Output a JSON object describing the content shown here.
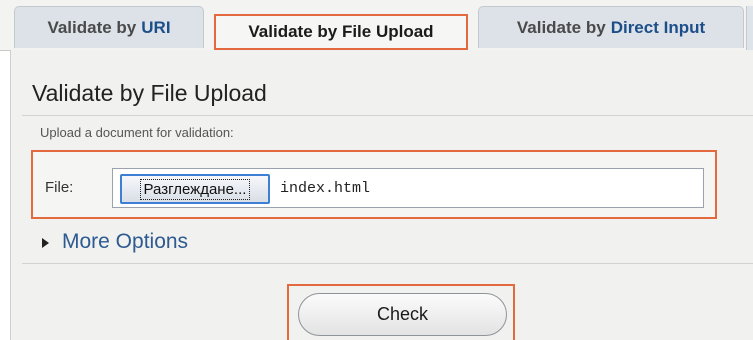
{
  "tabs": [
    {
      "prefix": "Validate by",
      "accent": "URI"
    },
    {
      "label": "Validate by File Upload"
    },
    {
      "prefix": "Validate by",
      "accent": "Direct Input"
    }
  ],
  "section": {
    "heading": "Validate by File Upload",
    "description": "Upload a document for validation:"
  },
  "file": {
    "label": "File:",
    "browse_label": "Разглеждане...",
    "file_name": "index.html"
  },
  "more_options": {
    "label": "More Options"
  },
  "check": {
    "label": "Check"
  },
  "colors": {
    "highlight": "#e26a3e",
    "link": "#2d5a91",
    "tab_accent": "#1c4f8a"
  },
  "icons": {
    "more_options": "triangle-right-icon"
  }
}
